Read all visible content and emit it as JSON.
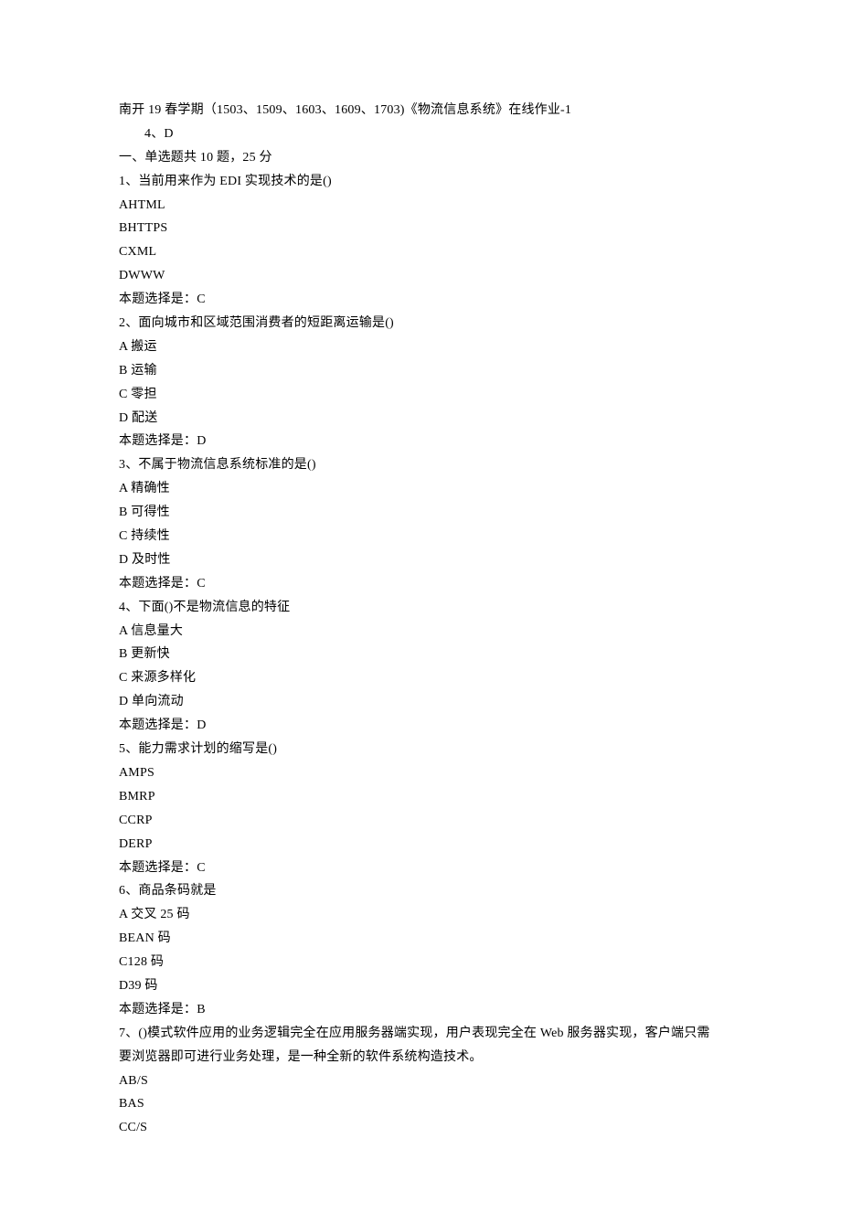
{
  "lines": [
    {
      "key": "l0",
      "indent": false,
      "text": "南开 19 春学期（1503、1509、1603、1609、1703)《物流信息系统》在线作业-1"
    },
    {
      "key": "l1",
      "indent": true,
      "text": "4、D"
    },
    {
      "key": "l2",
      "indent": false,
      "text": "一、单选题共 10 题，25 分"
    },
    {
      "key": "l3",
      "indent": false,
      "text": "1、当前用来作为 EDI 实现技术的是()"
    },
    {
      "key": "l4",
      "indent": false,
      "text": "AHTML"
    },
    {
      "key": "l5",
      "indent": false,
      "text": "BHTTPS"
    },
    {
      "key": "l6",
      "indent": false,
      "text": "CXML"
    },
    {
      "key": "l7",
      "indent": false,
      "text": "DWWW"
    },
    {
      "key": "l8",
      "indent": false,
      "text": "本题选择是：C"
    },
    {
      "key": "l9",
      "indent": false,
      "text": "2、面向城市和区域范围消费者的短距离运输是()"
    },
    {
      "key": "l10",
      "indent": false,
      "text": "A 搬运"
    },
    {
      "key": "l11",
      "indent": false,
      "text": "B 运输"
    },
    {
      "key": "l12",
      "indent": false,
      "text": "C 零担"
    },
    {
      "key": "l13",
      "indent": false,
      "text": "D 配送"
    },
    {
      "key": "l14",
      "indent": false,
      "text": "本题选择是：D"
    },
    {
      "key": "l15",
      "indent": false,
      "text": "3、不属于物流信息系统标准的是()"
    },
    {
      "key": "l16",
      "indent": false,
      "text": "A 精确性"
    },
    {
      "key": "l17",
      "indent": false,
      "text": "B 可得性"
    },
    {
      "key": "l18",
      "indent": false,
      "text": "C 持续性"
    },
    {
      "key": "l19",
      "indent": false,
      "text": "D 及时性"
    },
    {
      "key": "l20",
      "indent": false,
      "text": "本题选择是：C"
    },
    {
      "key": "l21",
      "indent": false,
      "text": "4、下面()不是物流信息的特征"
    },
    {
      "key": "l22",
      "indent": false,
      "text": "A 信息量大"
    },
    {
      "key": "l23",
      "indent": false,
      "text": "B 更新快"
    },
    {
      "key": "l24",
      "indent": false,
      "text": "C 来源多样化"
    },
    {
      "key": "l25",
      "indent": false,
      "text": "D 单向流动"
    },
    {
      "key": "l26",
      "indent": false,
      "text": "本题选择是：D"
    },
    {
      "key": "l27",
      "indent": false,
      "text": "5、能力需求计划的缩写是()"
    },
    {
      "key": "l28",
      "indent": false,
      "text": "AMPS"
    },
    {
      "key": "l29",
      "indent": false,
      "text": "BMRP"
    },
    {
      "key": "l30",
      "indent": false,
      "text": "CCRP"
    },
    {
      "key": "l31",
      "indent": false,
      "text": "DERP"
    },
    {
      "key": "l32",
      "indent": false,
      "text": "本题选择是：C"
    },
    {
      "key": "l33",
      "indent": false,
      "text": "6、商品条码就是"
    },
    {
      "key": "l34",
      "indent": false,
      "text": "A 交叉 25 码"
    },
    {
      "key": "l35",
      "indent": false,
      "text": "BEAN 码"
    },
    {
      "key": "l36",
      "indent": false,
      "text": "C128 码"
    },
    {
      "key": "l37",
      "indent": false,
      "text": "D39 码"
    },
    {
      "key": "l38",
      "indent": false,
      "text": "本题选择是：B"
    },
    {
      "key": "l39",
      "indent": false,
      "text": "7、()模式软件应用的业务逻辑完全在应用服务器端实现，用户表现完全在 Web 服务器实现，客户端只需要浏览器即可进行业务处理，是一种全新的软件系统构造技术。"
    },
    {
      "key": "l40",
      "indent": false,
      "text": "AB/S"
    },
    {
      "key": "l41",
      "indent": false,
      "text": "BAS"
    },
    {
      "key": "l42",
      "indent": false,
      "text": "CC/S"
    }
  ]
}
